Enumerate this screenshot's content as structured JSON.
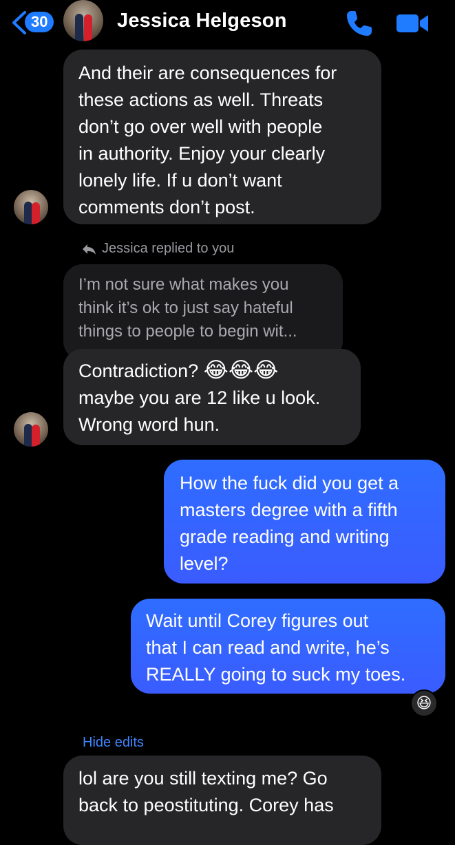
{
  "header": {
    "back_count": "30",
    "contact_name": "Jessica Helgeson",
    "icons": [
      "back-chevron-icon",
      "phone-icon",
      "video-camera-icon"
    ]
  },
  "messages": {
    "m1": {
      "line1": "And their are consequences for",
      "line2": "these actions as well. Threats",
      "line3": "don’t go over well with people",
      "line4": "in authority. Enjoy your clearly",
      "line5": "lonely life. If u don’t want",
      "line6": "comments don’t post."
    },
    "reply_note": "Jessica replied to you",
    "quoted": {
      "line1": "I’m not sure what makes you",
      "line2": "think it’s ok to just say hateful",
      "line3": "things to people to begin wit..."
    },
    "m2": {
      "line1": "Contradiction?",
      "emoji": "😂😂😂",
      "line2": "maybe you are 12 like u look.",
      "line3": "Wrong word hun."
    },
    "m3": {
      "line1": "How the fuck did you get a",
      "line2": "masters degree with a fifth",
      "line3": "grade reading and writing",
      "line4": "level?"
    },
    "m4": {
      "line1": "Wait until Corey figures out",
      "line2": "that I can read and write, he’s",
      "line3": "REALLY going to suck my toes.",
      "reaction": "😆"
    },
    "hide_edits": "Hide edits",
    "m5": {
      "line1": "lol are you still texting me? Go",
      "line2": "back to peostituting. Corey has"
    }
  },
  "colors": {
    "background": "#000000",
    "incoming_bubble": "#262628",
    "outgoing_bubble": "#3a5cff",
    "accent": "#1f7cff"
  }
}
